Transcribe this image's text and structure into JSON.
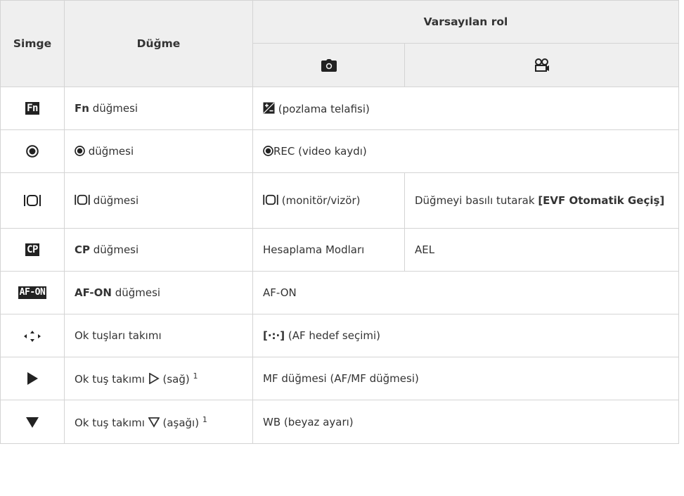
{
  "header": {
    "col_icon": "Simge",
    "col_button": "Düğme",
    "col_default_role": "Varsayılan rol",
    "photo_icon": "camera-icon",
    "video_icon": "movie-icon"
  },
  "rows": [
    {
      "icon": "fn-icon",
      "icon_text": "Fn",
      "button_bold": "Fn",
      "button_text": " düğmesi",
      "role": "(pozlama telafisi)",
      "role_icon": "exposure-compensation-icon"
    },
    {
      "icon": "record-icon",
      "button_text": " düğmesi",
      "role_prefix": "REC",
      "role": " (video kaydı)"
    },
    {
      "icon": "lv-switch-icon",
      "button_text": " düğmesi",
      "role_photo": " (monitör/vizör)",
      "role_video_text": "Düğmeyi basılı tutarak ",
      "role_video_bold": "[EVF Otomatik Geçiş]"
    },
    {
      "icon": "cp-icon",
      "icon_text": "CP",
      "button_bold": "CP",
      "button_text": " düğmesi",
      "role_photo": "Hesaplama Modları",
      "role_video": "AEL"
    },
    {
      "icon": "af-on-icon",
      "icon_text": "AF-ON",
      "button_bold": "AF-ON",
      "button_text": " düğmesi",
      "role": "AF-ON"
    },
    {
      "icon": "arrow-pad-icon",
      "button_text": "Ok tuşları takımı",
      "role_bold": "[·:·]",
      "role": " (AF hedef seçimi)"
    },
    {
      "icon": "play-right-icon",
      "button_text": "Ok tuş takımı ",
      "button_suffix": " (sağ) ",
      "footnote": "1",
      "role": "MF düğmesi (AF/MF düğmesi)"
    },
    {
      "icon": "down-triangle-icon",
      "button_text": "Ok tuş takımı ",
      "button_suffix": " (aşağı) ",
      "footnote": "1",
      "role": "WB (beyaz ayarı)"
    }
  ]
}
